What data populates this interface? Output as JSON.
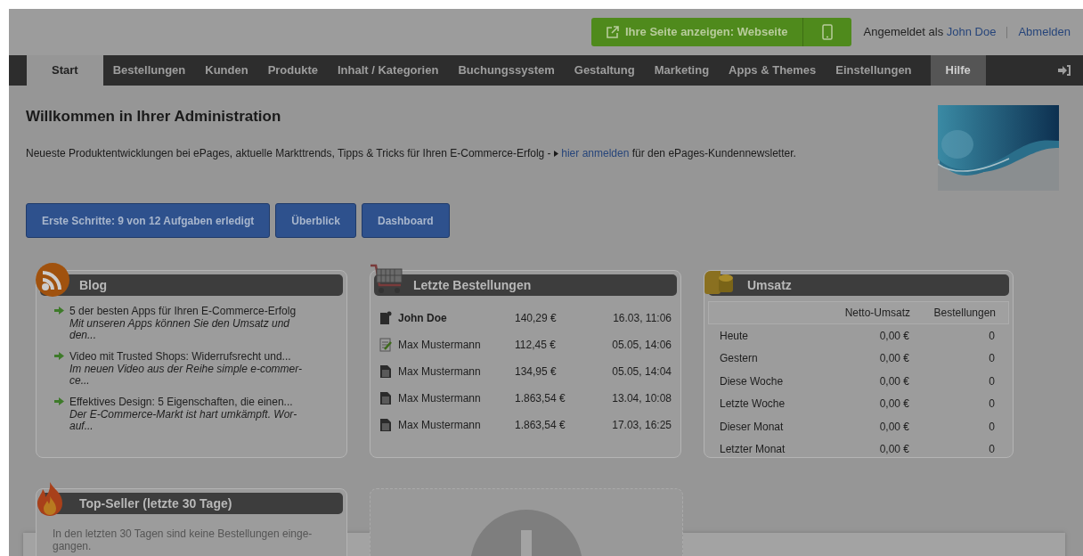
{
  "header": {
    "preview_button": "Ihre Seite anzeigen: Webseite",
    "logged_in_label": "Angemeldet als",
    "user": "John Doe",
    "logout": "Abmelden"
  },
  "nav": [
    {
      "label": "Start",
      "selected": true,
      "kind": "tab"
    },
    {
      "label": "Bestellungen",
      "selected": false,
      "kind": "tab"
    },
    {
      "label": "Kunden",
      "selected": false,
      "kind": "tab"
    },
    {
      "label": "Produkte",
      "selected": false,
      "kind": "tab"
    },
    {
      "label": "Inhalt / Kategorien",
      "selected": false,
      "kind": "tab"
    },
    {
      "label": "Buchungssystem",
      "selected": false,
      "kind": "tab"
    },
    {
      "label": "Gestaltung",
      "selected": false,
      "kind": "tab"
    },
    {
      "label": "Marketing",
      "selected": false,
      "kind": "tab"
    },
    {
      "label": "Apps & Themes",
      "selected": false,
      "kind": "tab"
    },
    {
      "label": "Einstellungen",
      "selected": false,
      "kind": "tab"
    },
    {
      "label": "Hilfe",
      "selected": false,
      "kind": "help"
    }
  ],
  "welcome": {
    "title": "Willkommen in Ihrer Administration",
    "text_before": "Neueste Produktentwicklungen bei ePages, aktuelle Markttrends, Tipps & Tricks für Ihren E-Commerce-Erfolg -",
    "link": "hier anmelden",
    "text_after": "für den ePages-Kundennewsletter."
  },
  "buttons": [
    "Erste Schritte: 9 von 12 Aufgaben erledigt",
    "Überblick",
    "Dashboard"
  ],
  "blog": {
    "title": "Blog",
    "items": [
      {
        "title": "5 der besten Apps für Ihren E-Commerce-Erfolg",
        "teaser": "Mit unseren Apps können Sie den Umsatz und den..."
      },
      {
        "title": "Video mit Trusted Shops: Widerrufsrecht und...",
        "teaser": "Im neuen Video aus der Reihe simple e-commer-ce..."
      },
      {
        "title": "Effektives Design: 5 Eigenschaften, die einen...",
        "teaser": "Der E-Commerce-Markt ist hart umkämpft. Wor-auf..."
      }
    ]
  },
  "orders": {
    "title": "Letzte Bestellungen",
    "rows": [
      {
        "kind": "new",
        "customer": "John Doe",
        "amount": "140,29 €",
        "date": "16.03, 11:06"
      },
      {
        "kind": "edited",
        "customer": "Max Mustermann",
        "amount": "112,45 €",
        "date": "05.05, 14:06"
      },
      {
        "kind": "document",
        "customer": "Max Mustermann",
        "amount": "134,95 €",
        "date": "05.05, 14:04"
      },
      {
        "kind": "document",
        "customer": "Max Mustermann",
        "amount": "1.863,54 €",
        "date": "13.04, 10:08"
      },
      {
        "kind": "document",
        "customer": "Max Mustermann",
        "amount": "1.863,54 €",
        "date": "17.03, 16:25"
      }
    ]
  },
  "revenue": {
    "title": "Umsatz",
    "columns": [
      "Netto-Umsatz",
      "Bestellungen"
    ],
    "rows": [
      {
        "period": "Heute",
        "net": "0,00 €",
        "orders": "0"
      },
      {
        "period": "Gestern",
        "net": "0,00 €",
        "orders": "0"
      },
      {
        "period": "Diese Woche",
        "net": "0,00 €",
        "orders": "0"
      },
      {
        "period": "Letzte Woche",
        "net": "0,00 €",
        "orders": "0"
      },
      {
        "period": "Dieser Monat",
        "net": "0,00 €",
        "orders": "0"
      },
      {
        "period": "Letzter Monat",
        "net": "0,00 €",
        "orders": "0"
      }
    ]
  },
  "top_seller": {
    "title": "Top-Seller (letzte 30 Tage)",
    "text": "In den letzten 30 Tagen sind keine Bestellungen einge-gangen."
  }
}
